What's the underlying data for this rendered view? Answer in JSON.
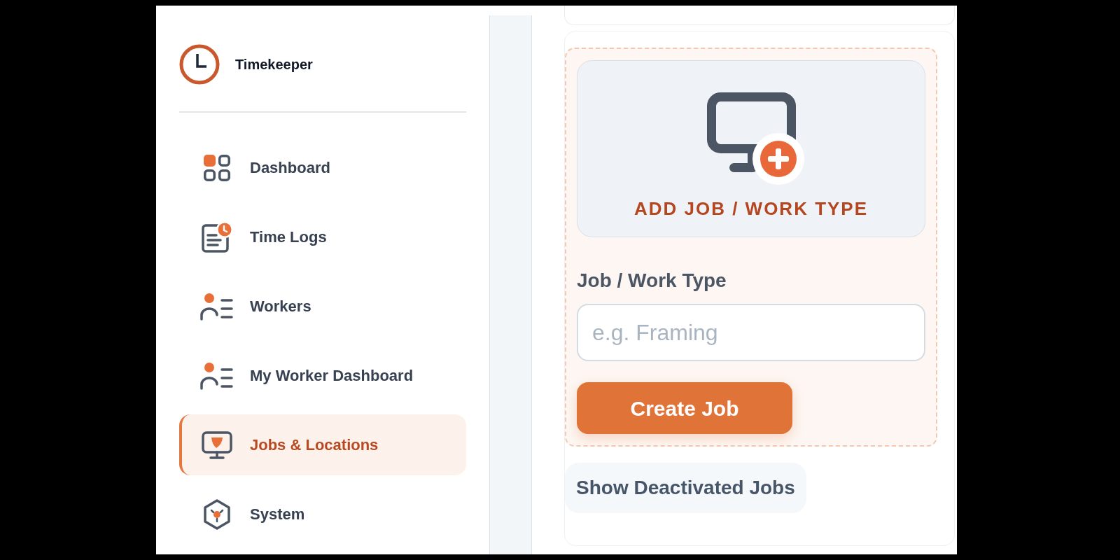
{
  "sidebar": {
    "brand": "Timekeeper",
    "items": [
      {
        "label": "Dashboard",
        "selected": false
      },
      {
        "label": "Time Logs",
        "selected": false
      },
      {
        "label": "Workers",
        "selected": false
      },
      {
        "label": "My Worker Dashboard",
        "selected": false
      },
      {
        "label": "Jobs & Locations",
        "selected": true
      },
      {
        "label": "System",
        "selected": false
      }
    ]
  },
  "job_form": {
    "add_card": {
      "title": "ADD JOB / WORK TYPE"
    },
    "field": {
      "label": "Job / Work Type",
      "placeholder": "e.g. Framing"
    },
    "submit_button": {
      "label": "Create Job"
    }
  },
  "show_deactivated_button": {
    "label": "Show Deactivated Jobs"
  }
}
